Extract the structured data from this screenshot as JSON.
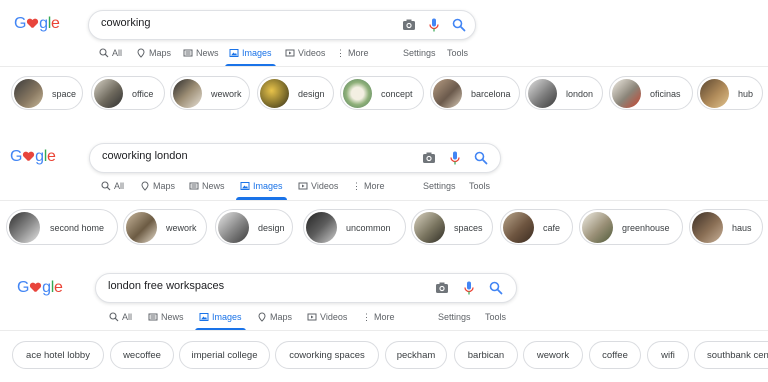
{
  "colors": {
    "accent": "#1a73e8",
    "logo_blue": "#4285f4",
    "logo_red": "#ea4335",
    "logo_yellow": "#fbbc05",
    "logo_green": "#34a853",
    "mic_red": "#ea4335"
  },
  "logo": {
    "g1": "G",
    "o1": "o",
    "rest": "gle"
  },
  "tabs_common": {
    "all": "All",
    "maps": "Maps",
    "news": "News",
    "images": "Images",
    "videos": "Videos",
    "more": "More",
    "settings": "Settings",
    "tools": "Tools"
  },
  "s1": {
    "query": "coworking",
    "chips": [
      "space",
      "office",
      "wework",
      "design",
      "concept",
      "barcelona",
      "london",
      "oficinas",
      "hub"
    ]
  },
  "s2": {
    "query": "coworking london",
    "chips": [
      "second home",
      "wework",
      "design",
      "uncommon",
      "spaces",
      "cafe",
      "greenhouse",
      "haus"
    ]
  },
  "s3": {
    "query": "london free workspaces",
    "chips": [
      "ace hotel lobby",
      "wecoffee",
      "imperial college",
      "coworking spaces",
      "peckham",
      "barbican",
      "wework",
      "coffee",
      "wifi",
      "southbank cen"
    ]
  }
}
